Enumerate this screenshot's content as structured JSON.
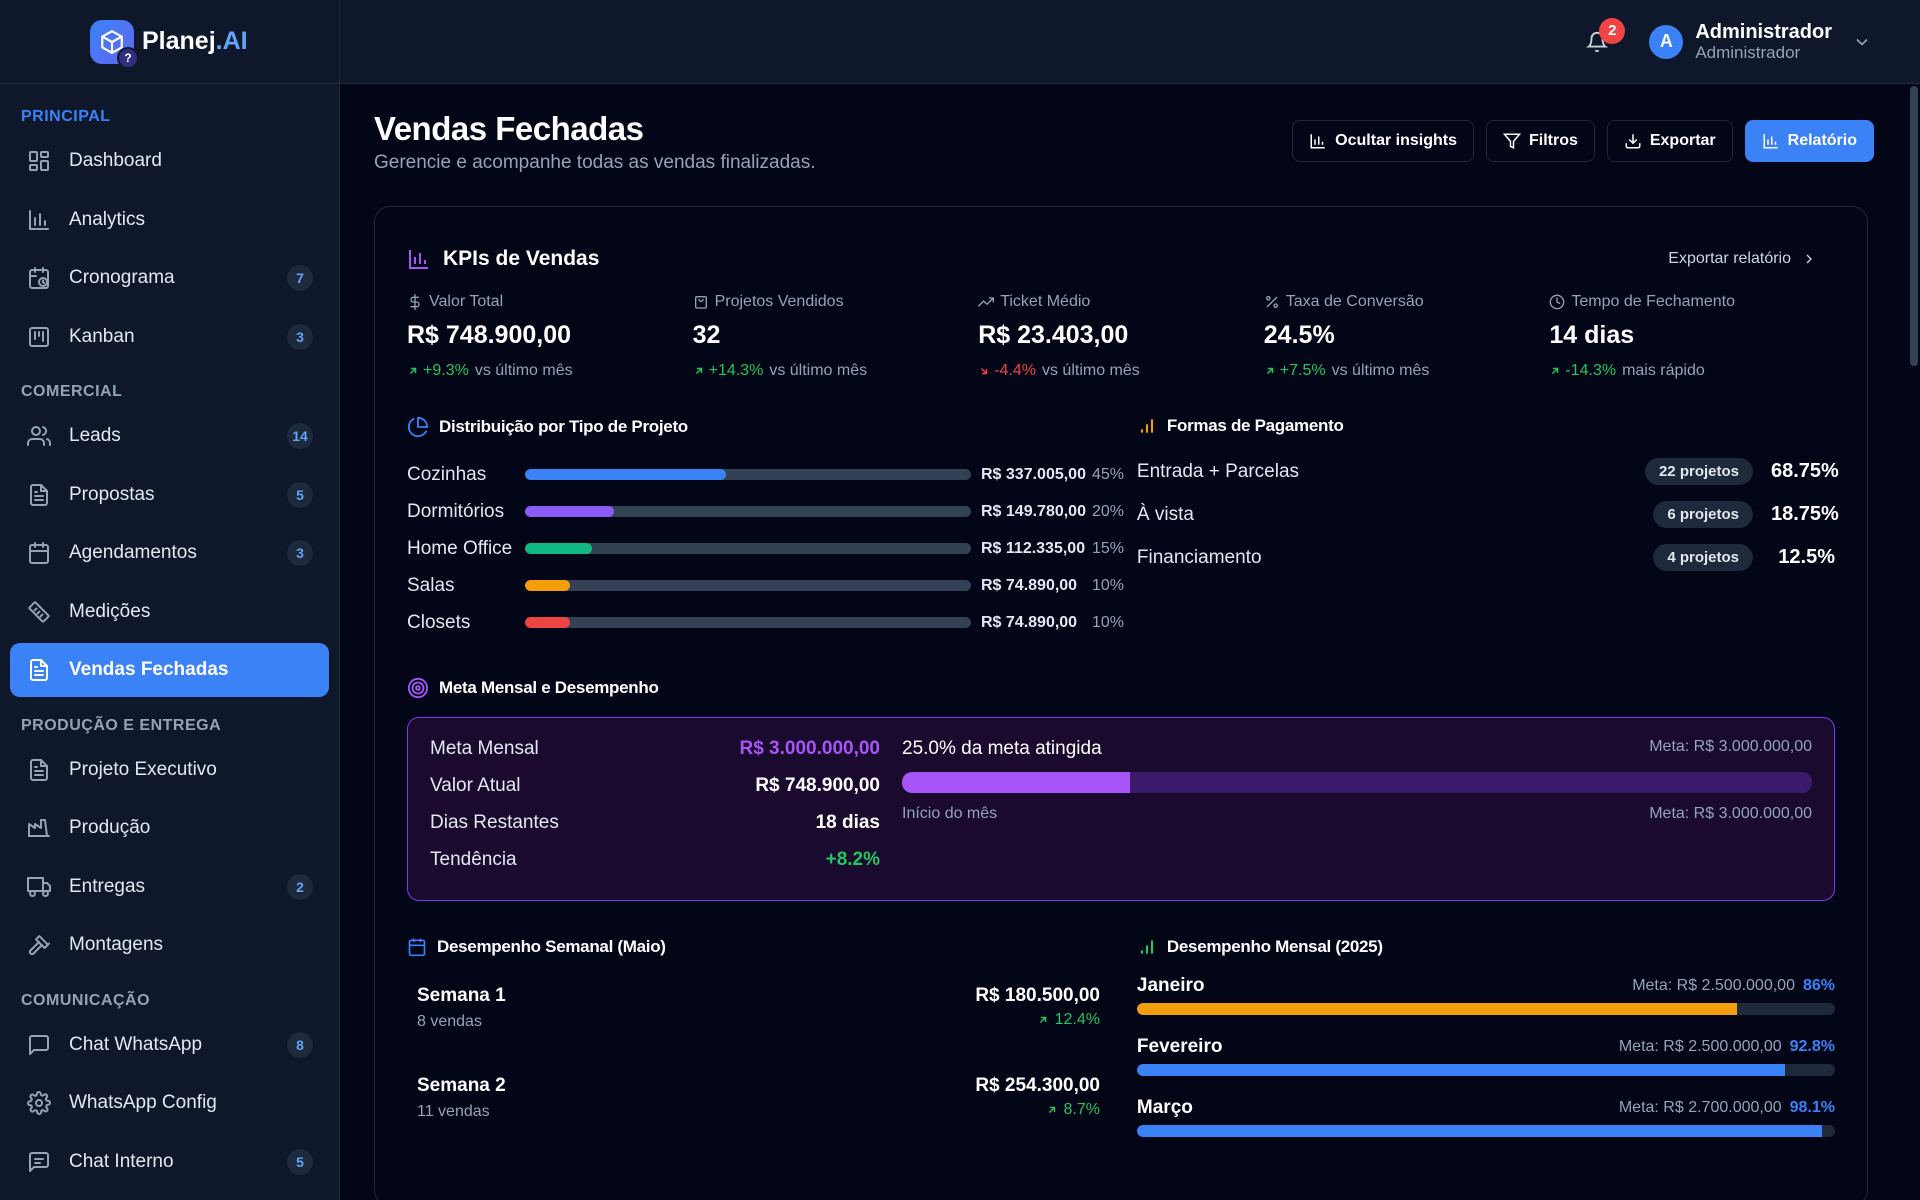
{
  "brand": {
    "name": "Planej",
    "suffix": ".AI"
  },
  "user": {
    "initial": "A",
    "name": "Administrador",
    "role": "Administrador",
    "notifications": "2"
  },
  "sidebar": {
    "sections": [
      {
        "label": "PRINCIPAL",
        "items": [
          {
            "label": "Dashboard",
            "icon": "dashboard-icon",
            "badge": ""
          },
          {
            "label": "Analytics",
            "icon": "analytics-icon",
            "badge": ""
          },
          {
            "label": "Cronograma",
            "icon": "calendar-clock-icon",
            "badge": "7"
          },
          {
            "label": "Kanban",
            "icon": "kanban-icon",
            "badge": "3"
          }
        ]
      },
      {
        "label": "COMERCIAL",
        "items": [
          {
            "label": "Leads",
            "icon": "users-icon",
            "badge": "14"
          },
          {
            "label": "Propostas",
            "icon": "document-icon",
            "badge": "5"
          },
          {
            "label": "Agendamentos",
            "icon": "calendar-icon",
            "badge": "3"
          },
          {
            "label": "Medições",
            "icon": "ruler-icon",
            "badge": ""
          },
          {
            "label": "Vendas Fechadas",
            "icon": "document-check-icon",
            "badge": "",
            "active": true
          }
        ]
      },
      {
        "label": "PRODUÇÃO E ENTREGA",
        "items": [
          {
            "label": "Projeto Executivo",
            "icon": "document-icon",
            "badge": ""
          },
          {
            "label": "Produção",
            "icon": "factory-icon",
            "badge": ""
          },
          {
            "label": "Entregas",
            "icon": "truck-icon",
            "badge": "2"
          },
          {
            "label": "Montagens",
            "icon": "hammer-icon",
            "badge": ""
          }
        ]
      },
      {
        "label": "COMUNICAÇÃO",
        "items": [
          {
            "label": "Chat WhatsApp",
            "icon": "chat-icon",
            "badge": "8"
          },
          {
            "label": "WhatsApp Config",
            "icon": "gear-icon",
            "badge": ""
          },
          {
            "label": "Chat Interno",
            "icon": "message-icon",
            "badge": "5"
          }
        ]
      }
    ]
  },
  "page": {
    "title": "Vendas Fechadas",
    "subtitle": "Gerencie e acompanhe todas as vendas finalizadas.",
    "buttons": {
      "insights": "Ocultar insights",
      "filters": "Filtros",
      "export": "Exportar",
      "report": "Relatório"
    }
  },
  "kpi_card": {
    "title": "KPIs de Vendas",
    "export_link": "Exportar relatório",
    "kpis": [
      {
        "label": "Valor Total",
        "icon": "dollar-icon",
        "value": "R$ 748.900,00",
        "change": "+9.3%",
        "trend": "up",
        "note": "vs último mês"
      },
      {
        "label": "Projetos Vendidos",
        "icon": "bag-icon",
        "value": "32",
        "change": "+14.3%",
        "trend": "up",
        "note": "vs último mês"
      },
      {
        "label": "Ticket Médio",
        "icon": "trend-icon",
        "value": "R$ 23.403,00",
        "change": "-4.4%",
        "trend": "down",
        "note": "vs último mês"
      },
      {
        "label": "Taxa de Conversão",
        "icon": "percent-icon",
        "value": "24.5%",
        "change": "+7.5%",
        "trend": "up",
        "note": "vs último mês"
      },
      {
        "label": "Tempo de Fechamento",
        "icon": "clock-icon",
        "value": "14 dias",
        "change": "-14.3%",
        "trend": "up",
        "note": "mais rápido"
      }
    ]
  },
  "distribution": {
    "title": "Distribuição por Tipo de Projeto",
    "rows": [
      {
        "label": "Cozinhas",
        "value": "R$ 337.005,00",
        "pct": "45%",
        "fraction": 0.45,
        "color": "#3b82f6"
      },
      {
        "label": "Dormitórios",
        "value": "R$ 149.780,00",
        "pct": "20%",
        "fraction": 0.2,
        "color": "#8b5cf6"
      },
      {
        "label": "Home Office",
        "value": "R$ 112.335,00",
        "pct": "15%",
        "fraction": 0.15,
        "color": "#10b981"
      },
      {
        "label": "Salas",
        "value": "R$ 74.890,00",
        "pct": "10%",
        "fraction": 0.1,
        "color": "#f59e0b"
      },
      {
        "label": "Closets",
        "value": "R$ 74.890,00",
        "pct": "10%",
        "fraction": 0.1,
        "color": "#ef4444"
      }
    ]
  },
  "payments": {
    "title": "Formas de Pagamento",
    "rows": [
      {
        "label": "Entrada + Parcelas",
        "count": "22 projetos",
        "pct": "68.75%"
      },
      {
        "label": "À vista",
        "count": "6 projetos",
        "pct": "18.75%"
      },
      {
        "label": "Financiamento",
        "count": "4 projetos",
        "pct": "12.5%"
      }
    ]
  },
  "goal": {
    "title": "Meta Mensal e Desempenho",
    "rows": [
      {
        "label": "Meta Mensal",
        "value": "R$ 3.000.000,00",
        "color": "#a855f7"
      },
      {
        "label": "Valor Atual",
        "value": "R$ 748.900,00",
        "color": "#ffffff"
      },
      {
        "label": "Dias Restantes",
        "value": "18 dias",
        "color": "#ffffff"
      },
      {
        "label": "Tendência",
        "value": "+8.2%",
        "color": "#22c55e"
      }
    ],
    "progress_text": "25.0% da meta atingida",
    "progress_meta": "Meta: R$ 3.000.000,00",
    "progress_fraction": 0.25,
    "start_label": "Início do mês",
    "end_label": "Meta: R$ 3.000.000,00"
  },
  "weekly": {
    "title": "Desempenho Semanal (Maio)",
    "rows": [
      {
        "name": "Semana 1",
        "sales": "8 vendas",
        "value": "R$ 180.500,00",
        "change": "12.4%"
      },
      {
        "name": "Semana 2",
        "sales": "11 vendas",
        "value": "R$ 254.300,00",
        "change": "8.7%"
      }
    ]
  },
  "monthly": {
    "title": "Desempenho Mensal (2025)",
    "rows": [
      {
        "name": "Janeiro",
        "meta": "Meta: R$ 2.500.000,00",
        "pct": "86%",
        "fraction": 0.86,
        "color": "#f59e0b"
      },
      {
        "name": "Fevereiro",
        "meta": "Meta: R$ 2.500.000,00",
        "pct": "92.8%",
        "fraction": 0.928,
        "color": "#3b82f6"
      },
      {
        "name": "Março",
        "meta": "Meta: R$ 2.700.000,00",
        "pct": "98.1%",
        "fraction": 0.981,
        "color": "#3b82f6"
      }
    ]
  },
  "colors": {
    "accent": "#3b82f6",
    "purple": "#a855f7",
    "positive": "#22c55e",
    "negative": "#ef4444",
    "background": "#020617",
    "panel": "#0f172a"
  }
}
